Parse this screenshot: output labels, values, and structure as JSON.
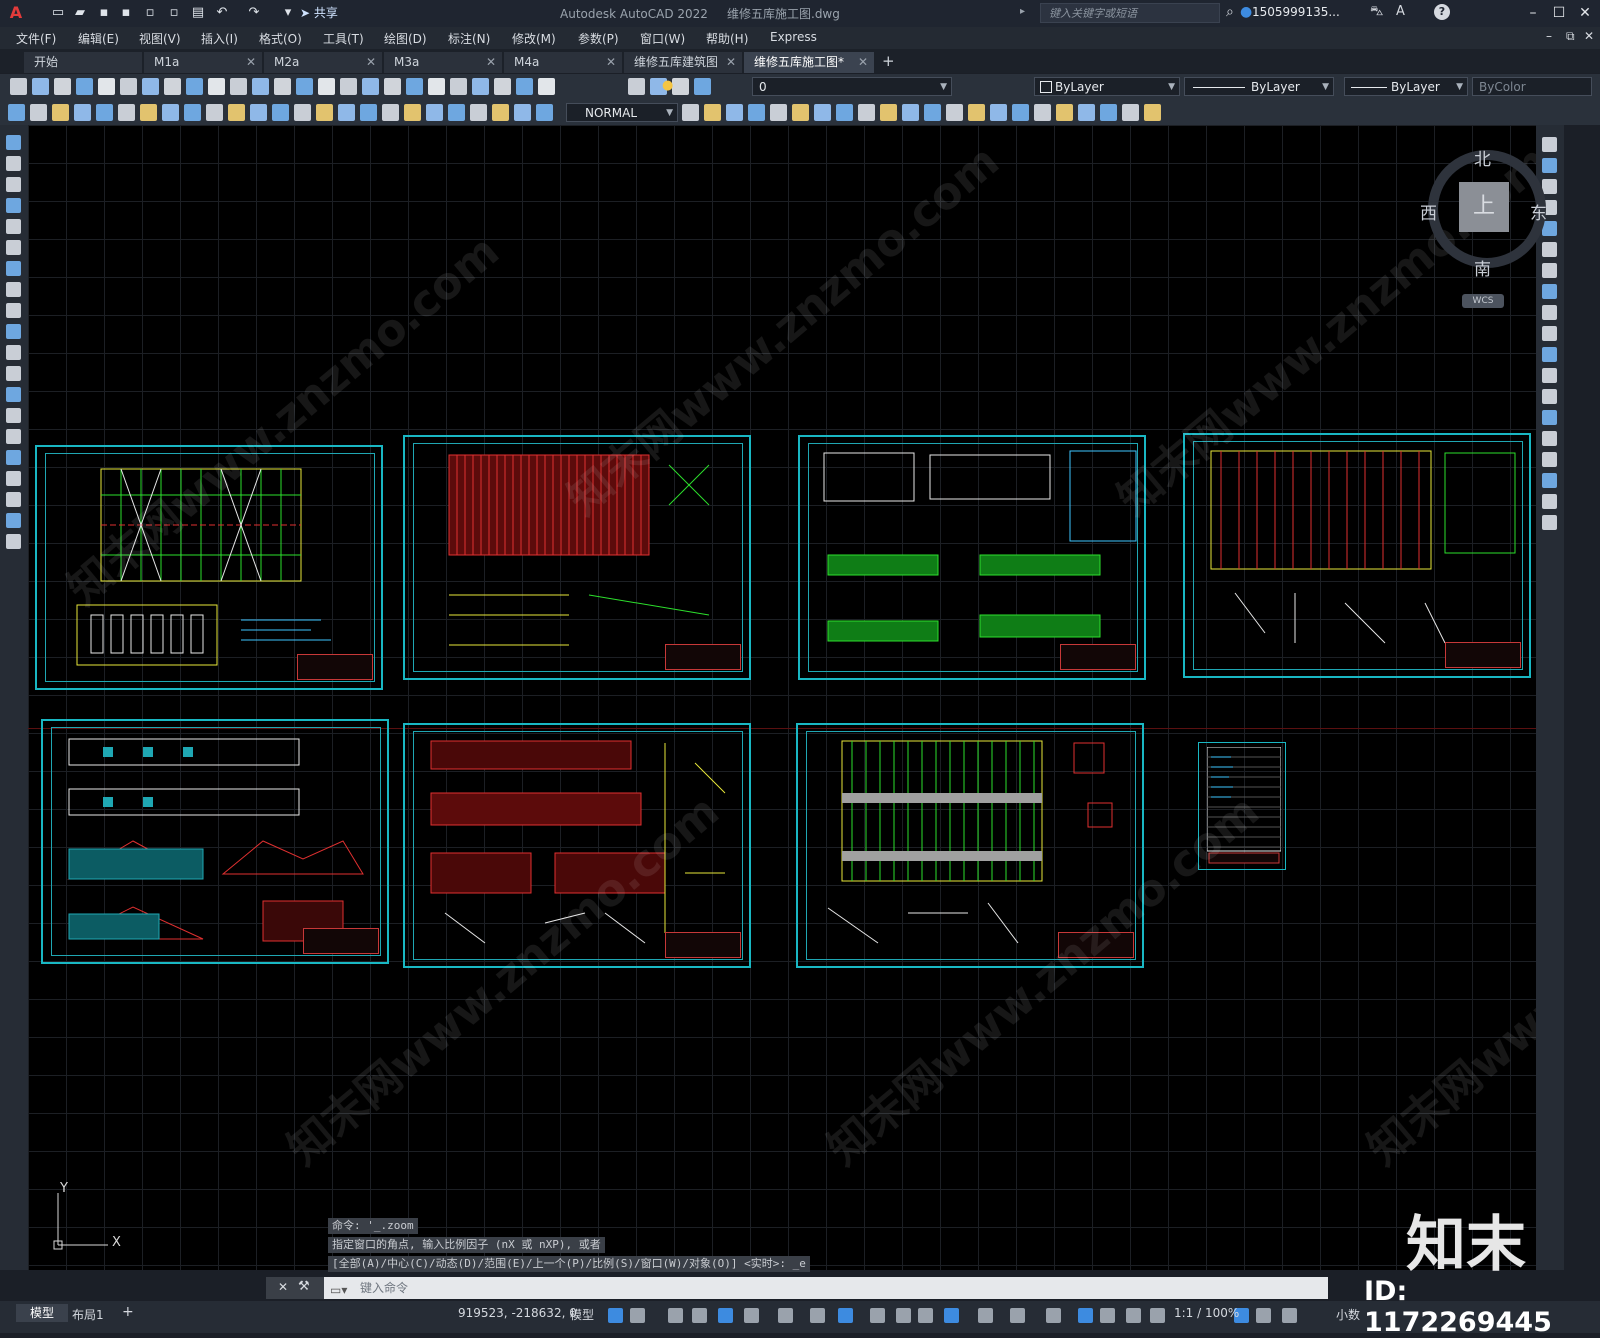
{
  "app": {
    "product": "Autodesk AutoCAD 2022",
    "file_name": "维修五库施工图.dwg",
    "share_label": "共享",
    "search_placeholder": "键入关键字或短语",
    "user_name": "1505999135..."
  },
  "menu": [
    "文件(F)",
    "编辑(E)",
    "视图(V)",
    "插入(I)",
    "格式(O)",
    "工具(T)",
    "绘图(D)",
    "标注(N)",
    "修改(M)",
    "参数(P)",
    "窗口(W)",
    "帮助(H)",
    "Express"
  ],
  "tabs": [
    {
      "label": "开始",
      "active": false
    },
    {
      "label": "M1a",
      "active": false
    },
    {
      "label": "M2a",
      "active": false
    },
    {
      "label": "M3a",
      "active": false
    },
    {
      "label": "M4a",
      "active": false
    },
    {
      "label": "维修五库建筑图",
      "active": false
    },
    {
      "label": "维修五库施工图*",
      "active": true
    }
  ],
  "properties": {
    "layer": "0",
    "color": "ByLayer",
    "linetype": "ByLayer",
    "lineweight": "ByLayer",
    "plotstyle": "ByColor",
    "dimstyle": "NORMAL"
  },
  "viewcube": {
    "north": "北",
    "south": "南",
    "east": "东",
    "west": "西",
    "top": "上",
    "ucs": "WCS"
  },
  "ucs_axes": {
    "x": "X",
    "y": "Y"
  },
  "command": {
    "history": [
      "命令: '_.zoom",
      "指定窗口的角点, 输入比例因子 (nX 或 nXP), 或者",
      "[全部(A)/中心(C)/动态(D)/范围(E)/上一个(P)/比例(S)/窗口(W)/对象(O)] <实时>: _e"
    ],
    "input_placeholder": "键入命令"
  },
  "layout_tabs": [
    "模型",
    "布局1"
  ],
  "status": {
    "coordinates": "919523, -218632, 0",
    "space": "模型",
    "scale": "1:1 / 100%",
    "units": "小数"
  },
  "watermark": {
    "site": "知末网www.znzmo.com",
    "brand": "知末",
    "id": "ID: 1172269445"
  },
  "colors": {
    "canvas": "#000000",
    "sheet_border": "#19b7c3",
    "accent": "#3d8be0"
  }
}
